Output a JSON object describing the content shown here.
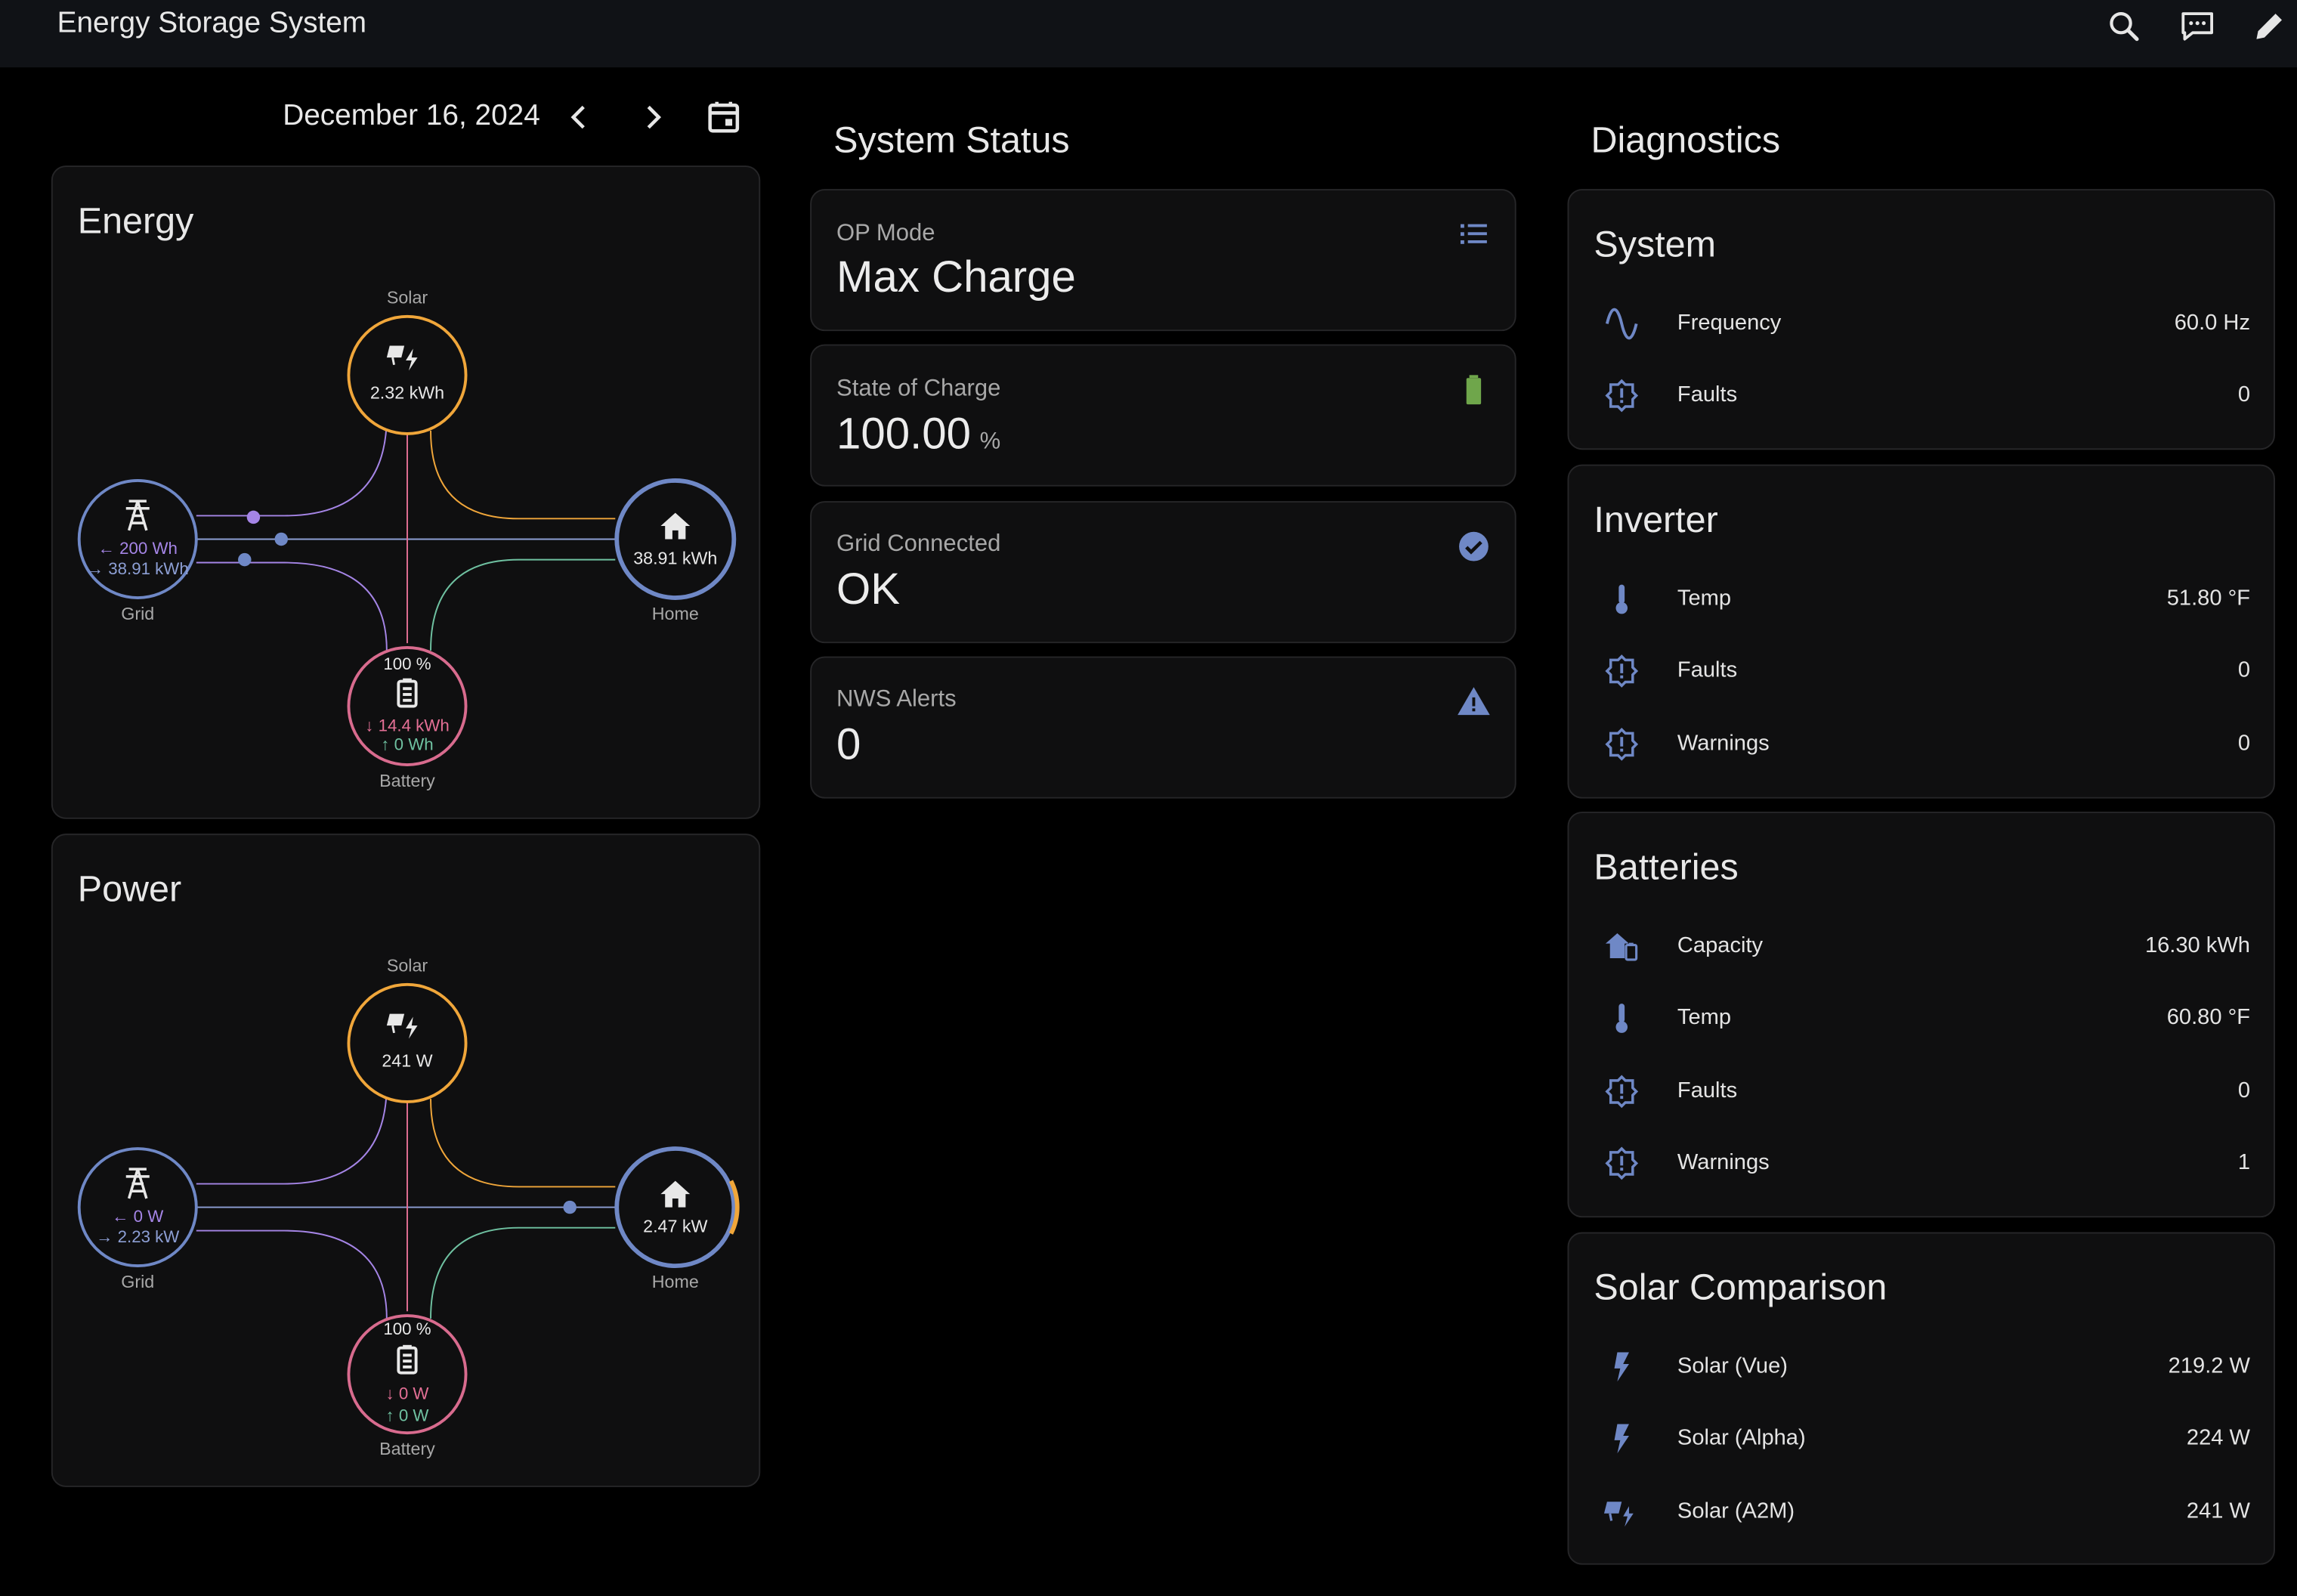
{
  "app": {
    "title": "Energy Storage System"
  },
  "toolbar": {
    "icons": [
      "search-icon",
      "assist-chat-icon",
      "edit-pencil-icon"
    ]
  },
  "date": {
    "label": "December 16, 2024"
  },
  "colors": {
    "solar": "#f0a63a",
    "grid": "#6f88c6",
    "home": "#6f88c6",
    "battery": "#d86b8e",
    "grid_in": "#a585e6",
    "grid_out": "#8d9fd4",
    "battery_in": "#e36f95",
    "battery_out": "#6fc1a1",
    "ok_green": "#6fa64b",
    "icon_blue": "#6f88c6"
  },
  "energy": {
    "title": "Energy",
    "solar": {
      "label": "Solar",
      "value": "2.32 kWh"
    },
    "grid": {
      "label": "Grid",
      "in": "200 Wh",
      "out": "38.91 kWh"
    },
    "home": {
      "label": "Home",
      "value": "38.91 kWh"
    },
    "battery": {
      "label": "Battery",
      "pct": "100 %",
      "in": "14.4 kWh",
      "out": "0 Wh"
    }
  },
  "power": {
    "title": "Power",
    "solar": {
      "label": "Solar",
      "value": "241 W"
    },
    "grid": {
      "label": "Grid",
      "in": "0 W",
      "out": "2.23 kW"
    },
    "home": {
      "label": "Home",
      "value": "2.47 kW"
    },
    "battery": {
      "label": "Battery",
      "pct": "100 %",
      "in": "0 W",
      "out": "0 W"
    }
  },
  "system_status": {
    "title": "System Status",
    "cards": [
      {
        "label": "OP Mode",
        "value": "Max Charge",
        "unit": "",
        "icon": "list-icon"
      },
      {
        "label": "State of Charge",
        "value": "100.00",
        "unit": "%",
        "icon": "battery-full-icon"
      },
      {
        "label": "Grid Connected",
        "value": "OK",
        "unit": "",
        "icon": "check-circle-icon"
      },
      {
        "label": "NWS Alerts",
        "value": "0",
        "unit": "",
        "icon": "alert-triangle-icon"
      }
    ]
  },
  "diagnostics": {
    "title": "Diagnostics",
    "system": {
      "title": "System",
      "rows": [
        {
          "icon": "sine-wave-icon",
          "label": "Frequency",
          "value": "60.0 Hz"
        },
        {
          "icon": "alert-badge-icon",
          "label": "Faults",
          "value": "0"
        }
      ]
    },
    "inverter": {
      "title": "Inverter",
      "rows": [
        {
          "icon": "thermometer-icon",
          "label": "Temp",
          "value": "51.80 °F"
        },
        {
          "icon": "alert-badge-icon",
          "label": "Faults",
          "value": "0"
        },
        {
          "icon": "alert-badge-icon",
          "label": "Warnings",
          "value": "0"
        }
      ]
    },
    "batteries": {
      "title": "Batteries",
      "rows": [
        {
          "icon": "home-battery-icon",
          "label": "Capacity",
          "value": "16.30 kWh"
        },
        {
          "icon": "thermometer-icon",
          "label": "Temp",
          "value": "60.80 °F"
        },
        {
          "icon": "alert-badge-icon",
          "label": "Faults",
          "value": "0"
        },
        {
          "icon": "alert-badge-icon",
          "label": "Warnings",
          "value": "1"
        }
      ]
    },
    "solar_comparison": {
      "title": "Solar Comparison",
      "rows": [
        {
          "icon": "lightning-icon",
          "label": "Solar (Vue)",
          "value": "219.2 W"
        },
        {
          "icon": "lightning-icon",
          "label": "Solar (Alpha)",
          "value": "224 W"
        },
        {
          "icon": "solar-power-icon",
          "label": "Solar (A2M)",
          "value": "241 W"
        }
      ]
    }
  }
}
